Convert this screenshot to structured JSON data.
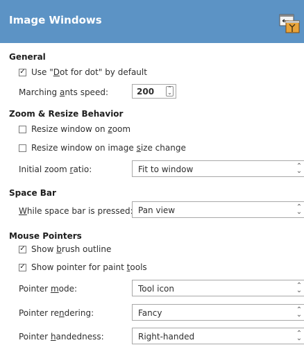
{
  "header": {
    "title": "Image Windows",
    "icon": "image-windows-preferences-icon"
  },
  "general": {
    "heading": "General",
    "dot_for_dot": {
      "checked": true,
      "label": "Use \"Dot for dot\" by default"
    },
    "marching_ants": {
      "label": "Marching ants speed:",
      "value": "200"
    }
  },
  "zoom": {
    "heading": "Zoom & Resize Behavior",
    "resize_on_zoom": {
      "checked": false,
      "label": "Resize window on zoom"
    },
    "resize_on_size_change": {
      "checked": false,
      "label": "Resize window on image size change"
    },
    "initial_zoom": {
      "label": "Initial zoom ratio:",
      "value": "Fit to window"
    }
  },
  "space_bar": {
    "heading": "Space Bar",
    "while_pressed": {
      "label": "While space bar is pressed:",
      "value": "Pan view"
    }
  },
  "mouse_pointers": {
    "heading": "Mouse Pointers",
    "show_brush_outline": {
      "checked": true,
      "label": "Show brush outline"
    },
    "show_pointer_paint": {
      "checked": true,
      "label": "Show pointer for paint tools"
    },
    "pointer_mode": {
      "label": "Pointer mode:",
      "value": "Tool icon"
    },
    "pointer_rendering": {
      "label": "Pointer rendering:",
      "value": "Fancy"
    },
    "pointer_handedness": {
      "label": "Pointer handedness:",
      "value": "Right-handed"
    }
  },
  "colors": {
    "header_bg": "#5c93c5",
    "header_text": "#ffffff"
  }
}
